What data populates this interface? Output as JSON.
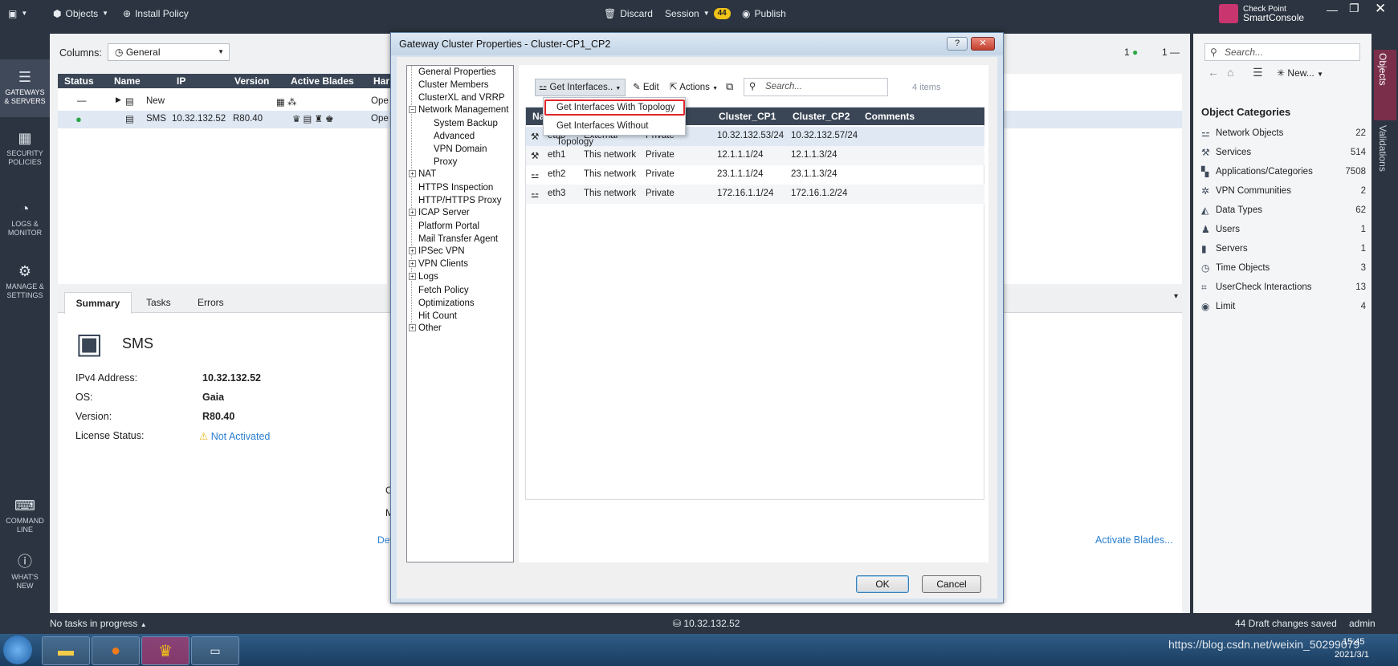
{
  "topbar": {
    "objects": "Objects",
    "install_policy": "Install Policy",
    "discard": "Discard",
    "session": "Session",
    "session_count": "44",
    "publish": "Publish",
    "brand_line1": "Check Point",
    "brand_line2": "SmartConsole"
  },
  "leftnav": [
    {
      "line1": "GATEWAYS",
      "line2": "& SERVERS"
    },
    {
      "line1": "SECURITY",
      "line2": "POLICIES"
    },
    {
      "line1": "LOGS &",
      "line2": "MONITOR"
    },
    {
      "line1": "MANAGE &",
      "line2": "SETTINGS"
    },
    {
      "line1": "COMMAND",
      "line2": "LINE"
    },
    {
      "line1": "WHAT'S",
      "line2": "NEW"
    }
  ],
  "main": {
    "columns_label": "Columns:",
    "columns_value": "General",
    "ok_count": "1",
    "dash_count": "1",
    "headers": [
      "Status",
      "Name",
      "IP",
      "Version",
      "Active Blades",
      "Har"
    ],
    "rows": [
      {
        "status": "—",
        "name": "New",
        "ip": "",
        "version": "",
        "har": "Ope"
      },
      {
        "status": "",
        "name": "SMS",
        "ip": "10.32.132.52",
        "version": "R80.40",
        "har": "Ope"
      }
    ],
    "tabs": [
      "Summary",
      "Tasks",
      "Errors"
    ],
    "summary": {
      "title": "SMS",
      "ipv4_label": "IPv4 Address:",
      "ipv4_value": "10.32.132.52",
      "os_label": "OS:",
      "os_value": "Gaia",
      "version_label": "Version:",
      "version_value": "R80.40",
      "license_label": "License Status:",
      "license_value": "Not Activated",
      "cp_fragment": "CP",
      "me_fragment": "Me",
      "devi_fragment": "Devi",
      "activate_blades": "Activate Blades..."
    }
  },
  "dialog": {
    "title": "Gateway Cluster Properties - Cluster-CP1_CP2",
    "tree": [
      {
        "label": "General Properties",
        "level": 0,
        "expander": ""
      },
      {
        "label": "Cluster Members",
        "level": 0,
        "expander": ""
      },
      {
        "label": "ClusterXL and VRRP",
        "level": 0,
        "expander": ""
      },
      {
        "label": "Network Management",
        "level": 0,
        "expander": "−"
      },
      {
        "label": "System Backup",
        "level": 1,
        "expander": ""
      },
      {
        "label": "Advanced",
        "level": 1,
        "expander": ""
      },
      {
        "label": "VPN Domain",
        "level": 1,
        "expander": ""
      },
      {
        "label": "Proxy",
        "level": 1,
        "expander": ""
      },
      {
        "label": "NAT",
        "level": 0,
        "expander": "+"
      },
      {
        "label": "HTTPS Inspection",
        "level": 0,
        "expander": ""
      },
      {
        "label": "HTTP/HTTPS Proxy",
        "level": 0,
        "expander": ""
      },
      {
        "label": "ICAP Server",
        "level": 0,
        "expander": "+"
      },
      {
        "label": "Platform Portal",
        "level": 0,
        "expander": ""
      },
      {
        "label": "Mail Transfer Agent",
        "level": 0,
        "expander": ""
      },
      {
        "label": "IPSec VPN",
        "level": 0,
        "expander": "+"
      },
      {
        "label": "VPN Clients",
        "level": 0,
        "expander": "+"
      },
      {
        "label": "Logs",
        "level": 0,
        "expander": "+"
      },
      {
        "label": "Fetch Policy",
        "level": 0,
        "expander": ""
      },
      {
        "label": "Optimizations",
        "level": 0,
        "expander": ""
      },
      {
        "label": "Hit Count",
        "level": 0,
        "expander": ""
      },
      {
        "label": "Other",
        "level": 0,
        "expander": "+"
      }
    ],
    "toolbar": {
      "get_interfaces": "Get Interfaces..",
      "edit": "Edit",
      "actions": "Actions",
      "search_placeholder": "Search...",
      "item_count": "4 items"
    },
    "dropdown": [
      "Get Interfaces With Topology",
      "Get Interfaces Without Topology"
    ],
    "table_headers": [
      "Na",
      "Cluster_CP1",
      "Cluster_CP2",
      "Comments"
    ],
    "interfaces": [
      {
        "name": "eth0",
        "topology": "External",
        "type": "Private",
        "cp1": "10.32.132.53/24",
        "cp2": "10.32.132.57/24"
      },
      {
        "name": "eth1",
        "topology": "This network",
        "type": "Private",
        "cp1": "12.1.1.1/24",
        "cp2": "12.1.1.3/24"
      },
      {
        "name": "eth2",
        "topology": "This network",
        "type": "Private",
        "cp1": "23.1.1.1/24",
        "cp2": "23.1.1.3/24"
      },
      {
        "name": "eth3",
        "topology": "This network",
        "type": "Private",
        "cp1": "172.16.1.1/24",
        "cp2": "172.16.1.2/24"
      }
    ],
    "ok": "OK",
    "cancel": "Cancel"
  },
  "rightpanel": {
    "search_placeholder": "Search...",
    "new_label": "New...",
    "categories_title": "Object Categories",
    "categories": [
      {
        "label": "Network Objects",
        "count": "22",
        "icon": "network-icon"
      },
      {
        "label": "Services",
        "count": "514",
        "icon": "services-icon"
      },
      {
        "label": "Applications/Categories",
        "count": "7508",
        "icon": "applications-icon"
      },
      {
        "label": "VPN Communities",
        "count": "2",
        "icon": "vpn-icon"
      },
      {
        "label": "Data Types",
        "count": "62",
        "icon": "data-types-icon"
      },
      {
        "label": "Users",
        "count": "1",
        "icon": "users-icon"
      },
      {
        "label": "Servers",
        "count": "1",
        "icon": "servers-icon"
      },
      {
        "label": "Time Objects",
        "count": "3",
        "icon": "clock-icon"
      },
      {
        "label": "UserCheck Interactions",
        "count": "13",
        "icon": "usercheck-icon"
      },
      {
        "label": "Limit",
        "count": "4",
        "icon": "limit-icon"
      }
    ],
    "strip_objects": "Objects",
    "strip_validations": "Validations"
  },
  "statusbar": {
    "tasks": "No tasks in progress",
    "server": "10.32.132.52",
    "drafts": "44 Draft changes saved",
    "user": "admin"
  },
  "taskbar": {
    "time": "15:45",
    "date": "2021/3/1",
    "watermark": "https://blog.csdn.net/weixin_50299079"
  }
}
